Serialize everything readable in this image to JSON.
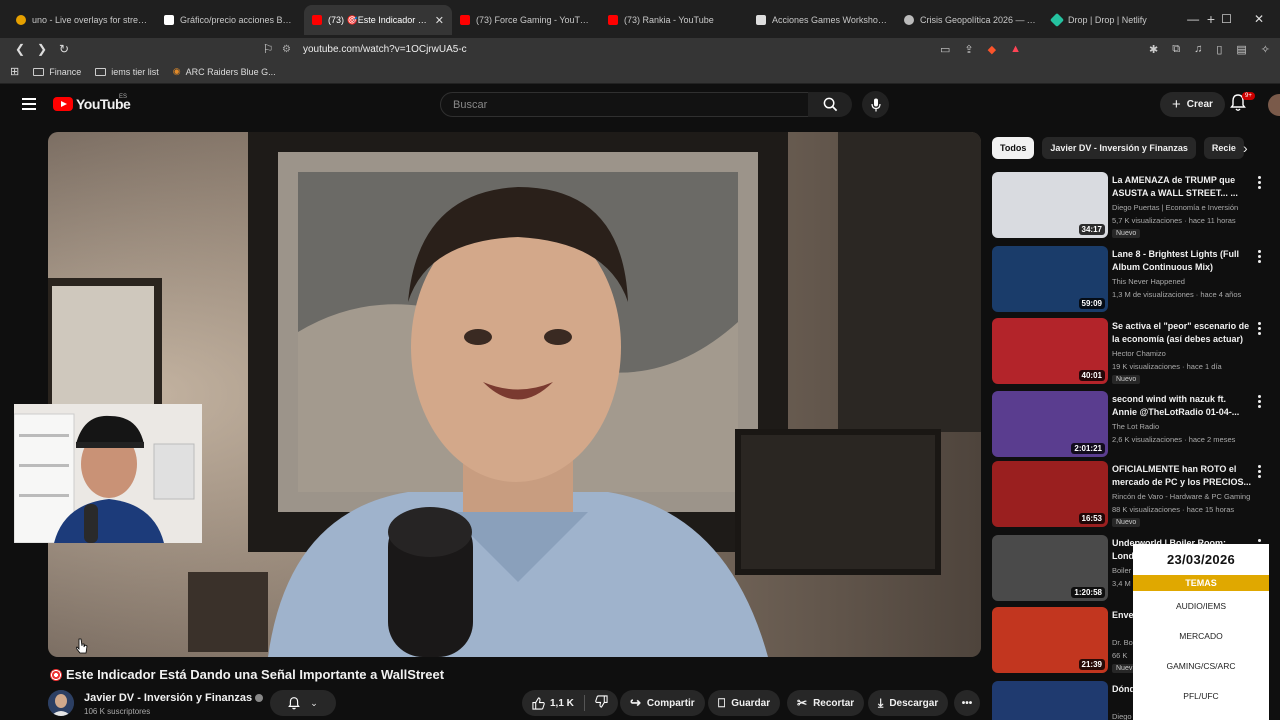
{
  "browser": {
    "tabs": [
      {
        "title": "uno - Live overlays for streami",
        "icon_color": "#e6a000",
        "active": false
      },
      {
        "title": "Gráfico/precio acciones BE: NY",
        "icon_color": "#ffffff",
        "active": false
      },
      {
        "title": "(73) 🎯Este Indicador Está",
        "icon_color": "#ff0000",
        "active": true
      },
      {
        "title": "(73) Force Gaming - YouTube",
        "icon_color": "#ff0000",
        "active": false
      },
      {
        "title": "(73) Rankia - YouTube",
        "icon_color": "#ff0000",
        "active": false
      },
      {
        "title": "Acciones Games Workshop ho",
        "icon_color": "#dddddd",
        "active": false
      },
      {
        "title": "Crisis Geopolítica 2026 — Análi",
        "icon_color": "#bbbbbb",
        "active": false
      },
      {
        "title": "Drop | Drop | Netlify",
        "icon_color": "#25c2a0",
        "active": false
      }
    ],
    "url": "youtube.com/watch?v=1OCjrwUA5-c",
    "bookmarks": [
      "Finance",
      "iems tier list",
      "ARC Raiders Blue G..."
    ]
  },
  "youtube": {
    "logo_text": "YouTube",
    "country": "ES",
    "search_placeholder": "Buscar",
    "create_label": "Crear",
    "notif_badge": "9+"
  },
  "video": {
    "title": "Este Indicador Está Dando una Señal Importante a WallStreet",
    "channel": "Javier DV - Inversión y Finanzas",
    "subscribers": "106 K suscriptores",
    "likes": "1,1 K",
    "actions": {
      "share": "Compartir",
      "save": "Guardar",
      "clip": "Recortar",
      "download": "Descargar"
    }
  },
  "sidebar": {
    "chips": [
      "Todos",
      "Javier DV - Inversión y Finanzas",
      "Recie"
    ],
    "recommendations": [
      {
        "title": "La AMENAZA de TRUMP que ASUSTA a WALL STREET... ...",
        "channel": "Diego Puertas | Economía e Inversión",
        "meta": "5,7 K visualizaciones · hace 11 horas",
        "duration": "34:17",
        "new": "Nuevo",
        "thumb": "#d9dbe0"
      },
      {
        "title": "Lane 8 - Brightest Lights (Full Album Continuous Mix)",
        "channel": "This Never Happened",
        "meta": "1,3 M de visualizaciones · hace 4 años",
        "duration": "59:09",
        "new": "",
        "thumb": "#1a3c6a"
      },
      {
        "title": "Se activa el \"peor\" escenario de la economía (así debes actuar)",
        "channel": "Hector Chamizo",
        "meta": "19 K visualizaciones · hace 1 día",
        "duration": "40:01",
        "new": "Nuevo",
        "thumb": "#b3242a"
      },
      {
        "title": "second wind with nazuk ft. Annie @TheLotRadio 01-04-...",
        "channel": "The Lot Radio",
        "meta": "2,6 K visualizaciones · hace 2 meses",
        "duration": "2:01:21",
        "new": "",
        "thumb": "#5a3d8f"
      },
      {
        "title": "OFICIALMENTE han ROTO el mercado de PC y los PRECIOS...",
        "channel": "Rincón de Varo - Hardware & PC Gaming",
        "meta": "88 K visualizaciones · hace 15 horas",
        "duration": "16:53",
        "new": "Nuevo",
        "thumb": "#9a1f1f"
      },
      {
        "title": "Underworld | Boiler Room: London",
        "channel": "Boiler",
        "meta": "3,4 M",
        "duration": "1:20:58",
        "new": "",
        "thumb": "#4a4a4a"
      },
      {
        "title": "Enve... Colá...",
        "channel": "Dr. Bo",
        "meta": "66 K",
        "duration": "21:39",
        "new": "Nuev",
        "thumb": "#c2361f"
      },
      {
        "title": "Dónd... invertir?",
        "channel": "Diego Puertas | Economía e Inversión",
        "meta": "",
        "duration": "",
        "new": "",
        "thumb": "#1f3a6f"
      }
    ]
  },
  "overlay": {
    "date": "23/03/2026",
    "header": "TEMAS",
    "items": [
      "AUDIO/IEMS",
      "MERCADO",
      "GAMING/CS/ARC",
      "PFL/UFC"
    ],
    "accent": "#e0a800"
  }
}
